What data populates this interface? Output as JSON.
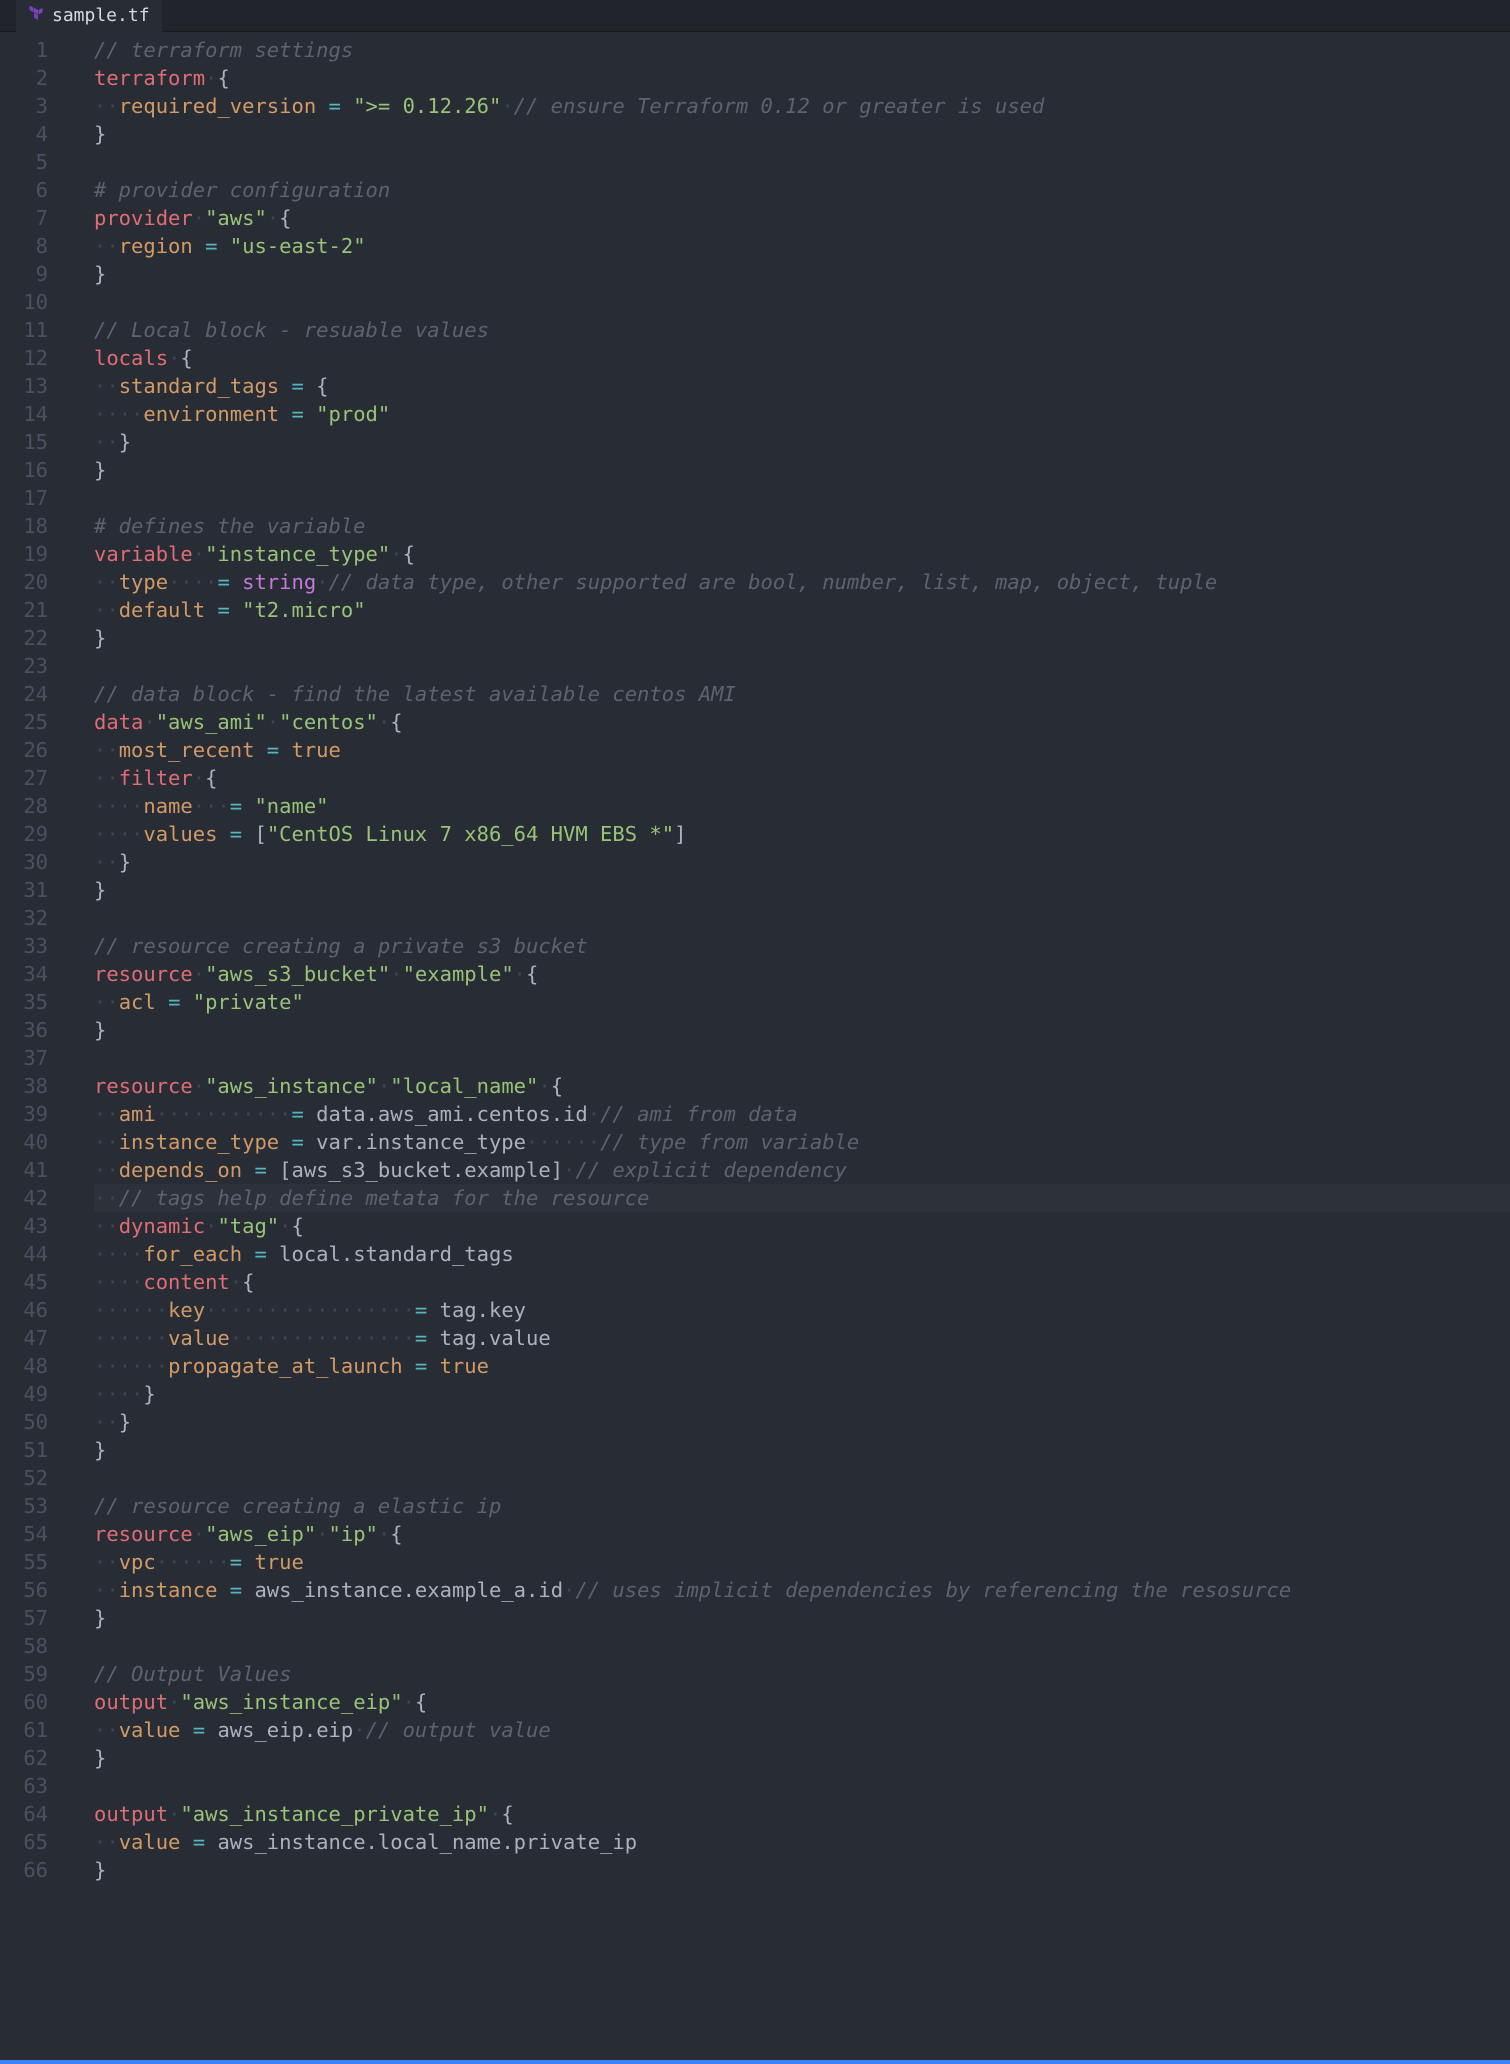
{
  "tab": {
    "filename": "sample.tf",
    "icon": "terraform-icon"
  },
  "line_count": 66,
  "active_line": 42,
  "colors": {
    "background": "#282c34",
    "gutter": "#495162",
    "comment": "#5c6370",
    "keyword": "#e06c75",
    "attr": "#d19a66",
    "string": "#98c379",
    "func": "#61afef",
    "type": "#c678dd",
    "op": "#56b6c2",
    "accent": "#3b82f6"
  },
  "code": [
    [
      [
        "c",
        "// terraform settings"
      ]
    ],
    [
      [
        "k",
        "terraform"
      ],
      [
        "d",
        "·"
      ],
      [
        "p",
        "{"
      ]
    ],
    [
      [
        "d",
        "··"
      ],
      [
        "a",
        "required_version"
      ],
      [
        "w",
        " "
      ],
      [
        "o",
        "="
      ],
      [
        "w",
        " "
      ],
      [
        "s",
        "\">= 0.12.26\""
      ],
      [
        "d",
        "·"
      ],
      [
        "c",
        "// ensure Terraform 0.12 or greater is used"
      ]
    ],
    [
      [
        "p",
        "}"
      ]
    ],
    [],
    [
      [
        "c",
        "# provider configuration"
      ]
    ],
    [
      [
        "k",
        "provider"
      ],
      [
        "d",
        "·"
      ],
      [
        "s",
        "\"aws\""
      ],
      [
        "d",
        "·"
      ],
      [
        "p",
        "{"
      ]
    ],
    [
      [
        "d",
        "··"
      ],
      [
        "a",
        "region"
      ],
      [
        "w",
        " "
      ],
      [
        "o",
        "="
      ],
      [
        "w",
        " "
      ],
      [
        "s",
        "\"us-east-2\""
      ]
    ],
    [
      [
        "p",
        "}"
      ]
    ],
    [],
    [
      [
        "c",
        "// Local block - resuable values"
      ]
    ],
    [
      [
        "k",
        "locals"
      ],
      [
        "d",
        "·"
      ],
      [
        "p",
        "{"
      ]
    ],
    [
      [
        "d",
        "··"
      ],
      [
        "a",
        "standard_tags"
      ],
      [
        "w",
        " "
      ],
      [
        "o",
        "="
      ],
      [
        "w",
        " "
      ],
      [
        "p",
        "{"
      ]
    ],
    [
      [
        "d",
        "····"
      ],
      [
        "a",
        "environment"
      ],
      [
        "w",
        " "
      ],
      [
        "o",
        "="
      ],
      [
        "w",
        " "
      ],
      [
        "s",
        "\"prod\""
      ]
    ],
    [
      [
        "d",
        "··"
      ],
      [
        "p",
        "}"
      ]
    ],
    [
      [
        "p",
        "}"
      ]
    ],
    [],
    [
      [
        "c",
        "# defines the variable"
      ]
    ],
    [
      [
        "k",
        "variable"
      ],
      [
        "d",
        "·"
      ],
      [
        "s",
        "\"instance_type\""
      ],
      [
        "d",
        "·"
      ],
      [
        "p",
        "{"
      ]
    ],
    [
      [
        "d",
        "··"
      ],
      [
        "a",
        "type"
      ],
      [
        "d",
        "····"
      ],
      [
        "o",
        "="
      ],
      [
        "w",
        " "
      ],
      [
        "t",
        "string"
      ],
      [
        "d",
        "·"
      ],
      [
        "c",
        "// data type, other supported are bool, number, list, map, object, tuple"
      ]
    ],
    [
      [
        "d",
        "··"
      ],
      [
        "a",
        "default"
      ],
      [
        "w",
        " "
      ],
      [
        "o",
        "="
      ],
      [
        "w",
        " "
      ],
      [
        "s",
        "\"t2.micro\""
      ]
    ],
    [
      [
        "p",
        "}"
      ]
    ],
    [],
    [
      [
        "c",
        "// data block - find the latest available centos AMI"
      ]
    ],
    [
      [
        "k",
        "data"
      ],
      [
        "d",
        "·"
      ],
      [
        "s",
        "\"aws_ami\""
      ],
      [
        "d",
        "·"
      ],
      [
        "s",
        "\"centos\""
      ],
      [
        "d",
        "·"
      ],
      [
        "p",
        "{"
      ]
    ],
    [
      [
        "d",
        "··"
      ],
      [
        "a",
        "most_recent"
      ],
      [
        "w",
        " "
      ],
      [
        "o",
        "="
      ],
      [
        "w",
        " "
      ],
      [
        "a",
        "true"
      ]
    ],
    [
      [
        "d",
        "··"
      ],
      [
        "k",
        "filter"
      ],
      [
        "d",
        "·"
      ],
      [
        "p",
        "{"
      ]
    ],
    [
      [
        "d",
        "····"
      ],
      [
        "a",
        "name"
      ],
      [
        "d",
        "···"
      ],
      [
        "o",
        "="
      ],
      [
        "w",
        " "
      ],
      [
        "s",
        "\"name\""
      ]
    ],
    [
      [
        "d",
        "····"
      ],
      [
        "a",
        "values"
      ],
      [
        "w",
        " "
      ],
      [
        "o",
        "="
      ],
      [
        "w",
        " "
      ],
      [
        "p",
        "["
      ],
      [
        "s",
        "\"CentOS Linux 7 x86_64 HVM EBS *\""
      ],
      [
        "p",
        "]"
      ]
    ],
    [
      [
        "d",
        "··"
      ],
      [
        "p",
        "}"
      ]
    ],
    [
      [
        "p",
        "}"
      ]
    ],
    [],
    [
      [
        "c",
        "// resource creating a private s3 bucket"
      ]
    ],
    [
      [
        "k",
        "resource"
      ],
      [
        "d",
        "·"
      ],
      [
        "s",
        "\"aws_s3_bucket\""
      ],
      [
        "d",
        "·"
      ],
      [
        "s",
        "\"example\""
      ],
      [
        "d",
        "·"
      ],
      [
        "p",
        "{"
      ]
    ],
    [
      [
        "d",
        "··"
      ],
      [
        "a",
        "acl"
      ],
      [
        "w",
        " "
      ],
      [
        "o",
        "="
      ],
      [
        "w",
        " "
      ],
      [
        "s",
        "\"private\""
      ]
    ],
    [
      [
        "p",
        "}"
      ]
    ],
    [],
    [
      [
        "k",
        "resource"
      ],
      [
        "d",
        "·"
      ],
      [
        "s",
        "\"aws_instance\""
      ],
      [
        "d",
        "·"
      ],
      [
        "s",
        "\"local_name\""
      ],
      [
        "d",
        "·"
      ],
      [
        "p",
        "{"
      ]
    ],
    [
      [
        "d",
        "··"
      ],
      [
        "a",
        "ami"
      ],
      [
        "d",
        "···········"
      ],
      [
        "o",
        "="
      ],
      [
        "w",
        " "
      ],
      [
        "w",
        "data"
      ],
      [
        "p",
        "."
      ],
      [
        "w",
        "aws_ami"
      ],
      [
        "p",
        "."
      ],
      [
        "w",
        "centos"
      ],
      [
        "p",
        "."
      ],
      [
        "w",
        "id"
      ],
      [
        "d",
        "·"
      ],
      [
        "c",
        "// ami from data"
      ]
    ],
    [
      [
        "d",
        "··"
      ],
      [
        "a",
        "instance_type"
      ],
      [
        "w",
        " "
      ],
      [
        "o",
        "="
      ],
      [
        "w",
        " "
      ],
      [
        "w",
        "var"
      ],
      [
        "p",
        "."
      ],
      [
        "w",
        "instance_type"
      ],
      [
        "d",
        "······"
      ],
      [
        "c",
        "// type from variable"
      ]
    ],
    [
      [
        "d",
        "··"
      ],
      [
        "a",
        "depends_on"
      ],
      [
        "w",
        " "
      ],
      [
        "o",
        "="
      ],
      [
        "w",
        " "
      ],
      [
        "p",
        "["
      ],
      [
        "w",
        "aws_s3_bucket"
      ],
      [
        "p",
        "."
      ],
      [
        "w",
        "example"
      ],
      [
        "p",
        "]"
      ],
      [
        "d",
        "·"
      ],
      [
        "c",
        "// explicit dependency"
      ]
    ],
    [
      [
        "d",
        "··"
      ],
      [
        "c",
        "// tags help define metata for the resource"
      ]
    ],
    [
      [
        "d",
        "··"
      ],
      [
        "k",
        "dynamic"
      ],
      [
        "d",
        "·"
      ],
      [
        "s",
        "\"tag\""
      ],
      [
        "d",
        "·"
      ],
      [
        "p",
        "{"
      ]
    ],
    [
      [
        "d",
        "····"
      ],
      [
        "a",
        "for_each"
      ],
      [
        "w",
        " "
      ],
      [
        "o",
        "="
      ],
      [
        "w",
        " "
      ],
      [
        "w",
        "local"
      ],
      [
        "p",
        "."
      ],
      [
        "w",
        "standard_tags"
      ]
    ],
    [
      [
        "d",
        "····"
      ],
      [
        "k",
        "content"
      ],
      [
        "d",
        "·"
      ],
      [
        "p",
        "{"
      ]
    ],
    [
      [
        "d",
        "······"
      ],
      [
        "a",
        "key"
      ],
      [
        "d",
        "·················"
      ],
      [
        "o",
        "="
      ],
      [
        "w",
        " "
      ],
      [
        "w",
        "tag"
      ],
      [
        "p",
        "."
      ],
      [
        "w",
        "key"
      ]
    ],
    [
      [
        "d",
        "······"
      ],
      [
        "a",
        "value"
      ],
      [
        "d",
        "···············"
      ],
      [
        "o",
        "="
      ],
      [
        "w",
        " "
      ],
      [
        "w",
        "tag"
      ],
      [
        "p",
        "."
      ],
      [
        "w",
        "value"
      ]
    ],
    [
      [
        "d",
        "······"
      ],
      [
        "a",
        "propagate_at_launch"
      ],
      [
        "w",
        " "
      ],
      [
        "o",
        "="
      ],
      [
        "w",
        " "
      ],
      [
        "a",
        "true"
      ]
    ],
    [
      [
        "d",
        "····"
      ],
      [
        "p",
        "}"
      ]
    ],
    [
      [
        "d",
        "··"
      ],
      [
        "p",
        "}"
      ]
    ],
    [
      [
        "p",
        "}"
      ]
    ],
    [],
    [
      [
        "c",
        "// resource creating a elastic ip"
      ]
    ],
    [
      [
        "k",
        "resource"
      ],
      [
        "d",
        "·"
      ],
      [
        "s",
        "\"aws_eip\""
      ],
      [
        "d",
        "·"
      ],
      [
        "s",
        "\"ip\""
      ],
      [
        "d",
        "·"
      ],
      [
        "p",
        "{"
      ]
    ],
    [
      [
        "d",
        "··"
      ],
      [
        "a",
        "vpc"
      ],
      [
        "d",
        "······"
      ],
      [
        "o",
        "="
      ],
      [
        "w",
        " "
      ],
      [
        "a",
        "true"
      ]
    ],
    [
      [
        "d",
        "··"
      ],
      [
        "a",
        "instance"
      ],
      [
        "w",
        " "
      ],
      [
        "o",
        "="
      ],
      [
        "w",
        " "
      ],
      [
        "w",
        "aws_instance"
      ],
      [
        "p",
        "."
      ],
      [
        "w",
        "example_a"
      ],
      [
        "p",
        "."
      ],
      [
        "w",
        "id"
      ],
      [
        "d",
        "·"
      ],
      [
        "c",
        "// uses implicit dependencies by referencing the resosurce"
      ]
    ],
    [
      [
        "p",
        "}"
      ]
    ],
    [],
    [
      [
        "c",
        "// Output Values"
      ]
    ],
    [
      [
        "k",
        "output"
      ],
      [
        "d",
        "·"
      ],
      [
        "s",
        "\"aws_instance_eip\""
      ],
      [
        "d",
        "·"
      ],
      [
        "p",
        "{"
      ]
    ],
    [
      [
        "d",
        "··"
      ],
      [
        "a",
        "value"
      ],
      [
        "w",
        " "
      ],
      [
        "o",
        "="
      ],
      [
        "w",
        " "
      ],
      [
        "w",
        "aws_eip"
      ],
      [
        "p",
        "."
      ],
      [
        "w",
        "eip"
      ],
      [
        "d",
        "·"
      ],
      [
        "c",
        "// output value"
      ]
    ],
    [
      [
        "p",
        "}"
      ]
    ],
    [],
    [
      [
        "k",
        "output"
      ],
      [
        "d",
        "·"
      ],
      [
        "s",
        "\"aws_instance_private_ip\""
      ],
      [
        "d",
        "·"
      ],
      [
        "p",
        "{"
      ]
    ],
    [
      [
        "d",
        "··"
      ],
      [
        "a",
        "value"
      ],
      [
        "w",
        " "
      ],
      [
        "o",
        "="
      ],
      [
        "w",
        " "
      ],
      [
        "w",
        "aws_instance"
      ],
      [
        "p",
        "."
      ],
      [
        "w",
        "local_name"
      ],
      [
        "p",
        "."
      ],
      [
        "w",
        "private_ip"
      ]
    ],
    [
      [
        "p",
        "}"
      ]
    ]
  ]
}
